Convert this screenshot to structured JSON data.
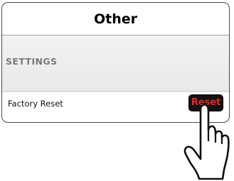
{
  "header": {
    "title": "Other"
  },
  "settings": {
    "section_label": "SETTINGS",
    "factory_reset": {
      "label": "Factory Reset",
      "button_label": "Reset"
    }
  },
  "colors": {
    "reset_text": "#e6271c",
    "reset_background": "#121212"
  },
  "icons": {
    "pointer": "pointing-hand-icon"
  }
}
